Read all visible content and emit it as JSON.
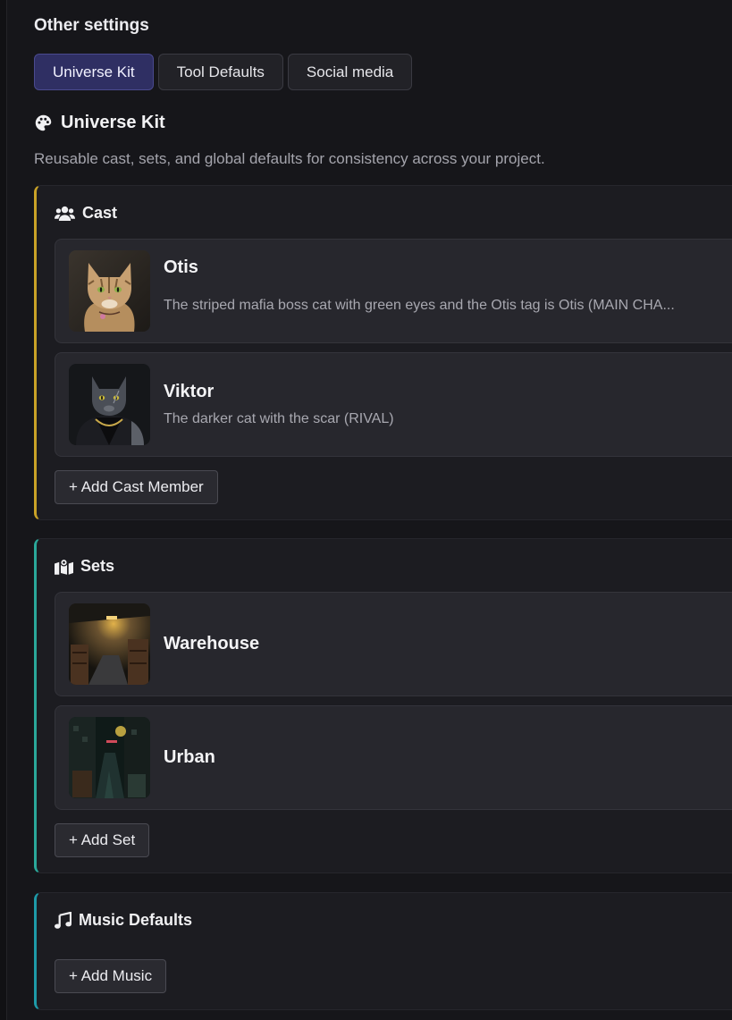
{
  "other_settings": {
    "title": "Other settings",
    "tabs": [
      {
        "label": "Universe Kit",
        "active": true
      },
      {
        "label": "Tool Defaults",
        "active": false
      },
      {
        "label": "Social media",
        "active": false
      }
    ]
  },
  "universe_kit": {
    "icon": "palette-icon",
    "title": "Universe Kit",
    "description": "Reusable cast, sets, and global defaults for consistency across your project.",
    "cast": {
      "icon": "users-icon",
      "label": "Cast",
      "accent": "#c9a227",
      "members": [
        {
          "name": "Otis",
          "description": "The striped mafia boss cat with green eyes and the Otis tag is Otis (MAIN CHA..."
        },
        {
          "name": "Viktor",
          "description": "The darker cat with the scar (RIVAL)"
        }
      ],
      "add_label": "+ Add Cast Member"
    },
    "sets": {
      "icon": "map-icon",
      "label": "Sets",
      "accent": "#2aa89a",
      "items": [
        {
          "name": "Warehouse"
        },
        {
          "name": "Urban"
        }
      ],
      "add_label": "+ Add Set"
    },
    "music": {
      "icon": "music-note-icon",
      "label": "Music Defaults",
      "accent": "#1e9aa8",
      "add_label": "+ Add Music"
    }
  }
}
